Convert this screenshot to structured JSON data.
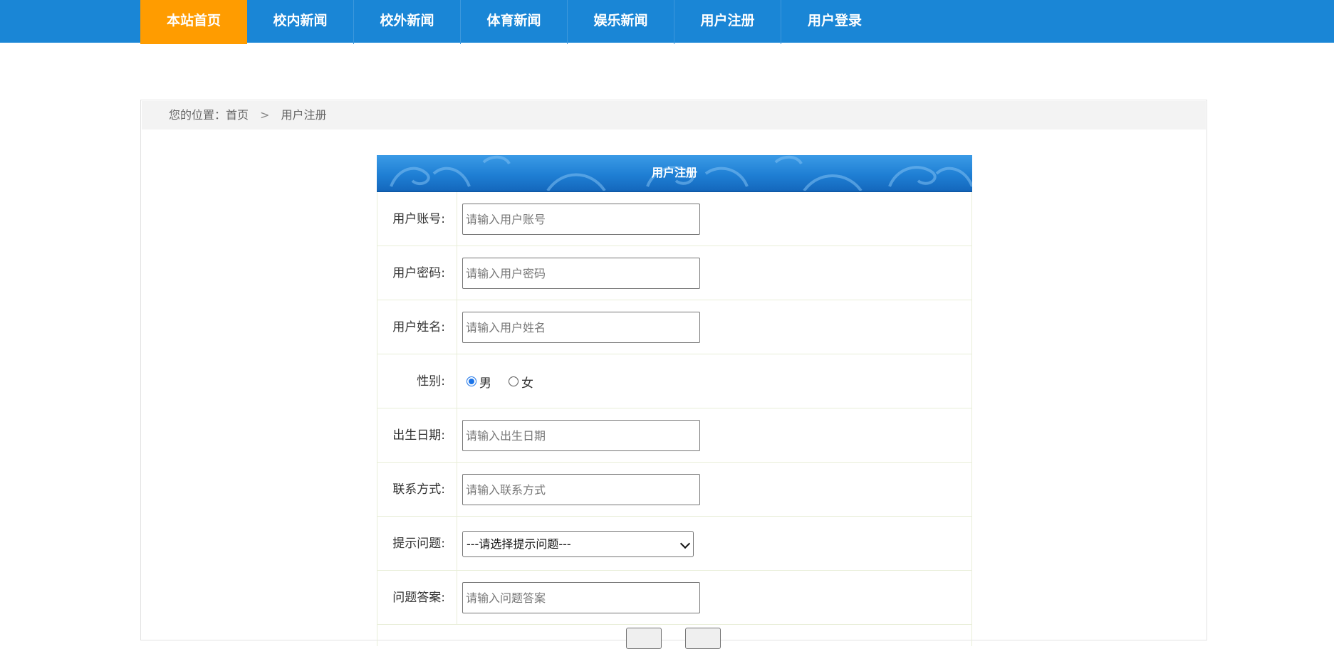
{
  "nav": {
    "items": [
      {
        "label": "本站首页",
        "active": true
      },
      {
        "label": "校内新闻"
      },
      {
        "label": "校外新闻"
      },
      {
        "label": "体育新闻"
      },
      {
        "label": "娱乐新闻"
      },
      {
        "label": "用户注册"
      },
      {
        "label": "用户登录"
      }
    ]
  },
  "breadcrumb": {
    "prefix": "您的位置：",
    "home": "首页",
    "current": "用户注册"
  },
  "form": {
    "title": "用户注册",
    "account": {
      "label": "用户账号:",
      "placeholder": "请输入用户账号",
      "value": ""
    },
    "password": {
      "label": "用户密码:",
      "placeholder": "请输入用户密码",
      "value": ""
    },
    "name": {
      "label": "用户姓名:",
      "placeholder": "请输入用户姓名",
      "value": ""
    },
    "gender": {
      "label": "性别:",
      "options": [
        "男",
        "女"
      ],
      "selected": "男"
    },
    "birthday": {
      "label": "出生日期:",
      "placeholder": "请输入出生日期",
      "value": ""
    },
    "contact": {
      "label": "联系方式:",
      "placeholder": "请输入联系方式",
      "value": ""
    },
    "question": {
      "label": "提示问题:",
      "selected": "---请选择提示问题---"
    },
    "answer": {
      "label": "问题答案:",
      "placeholder": "请输入问题答案",
      "value": ""
    }
  },
  "colors": {
    "nav_bg": "#1a86d6",
    "nav_active": "#ff9c00",
    "form_header": "#1f7fd4",
    "row_border": "#e8eed8"
  }
}
